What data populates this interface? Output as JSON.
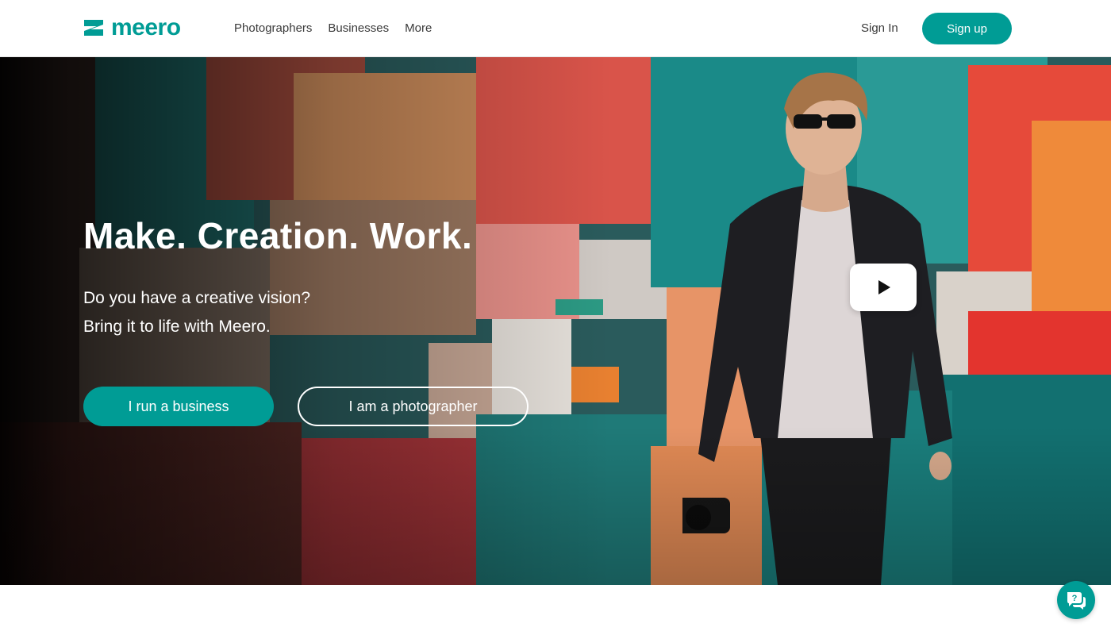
{
  "header": {
    "logo_text": "meero",
    "nav": [
      {
        "label": "Photographers"
      },
      {
        "label": "Businesses"
      },
      {
        "label": "More"
      }
    ],
    "sign_in": "Sign In",
    "sign_up": "Sign up"
  },
  "hero": {
    "title": "Make. Creation. Work.",
    "subtitle_line1": "Do you have a creative vision?",
    "subtitle_line2": "Bring it to life with Meero.",
    "business_button": "I run a business",
    "photographer_button": "I am a photographer",
    "play_icon": "play-icon"
  },
  "help": {
    "icon": "help-chat-icon"
  },
  "colors": {
    "brand": "#009c95",
    "text": "#3a3a3a",
    "background": "#ffffff"
  }
}
